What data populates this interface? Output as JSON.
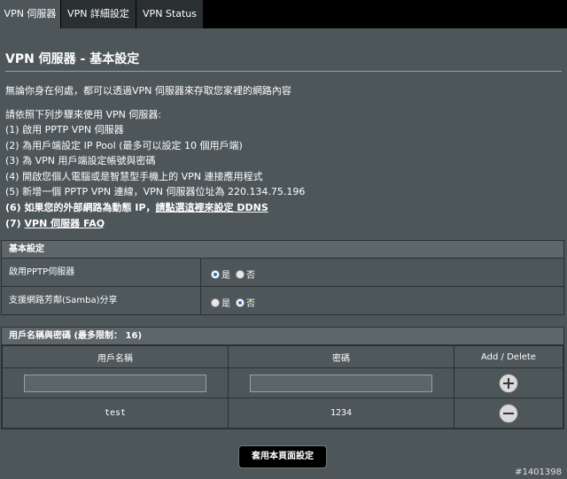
{
  "tabs": [
    {
      "label": "VPN 伺服器"
    },
    {
      "label": "VPN 詳細設定"
    },
    {
      "label": "VPN Status"
    }
  ],
  "page_title": "VPN 伺服器 - 基本設定",
  "intro": "無論你身在何處，都可以透過VPN 伺服器來存取您家裡的網路內容",
  "steps_heading": "請依照下列步驟來使用 VPN 伺服器:",
  "steps": [
    "(1) 啟用 PPTP VPN 伺服器",
    "(2) 為用戶端設定 IP Pool (最多可以設定 10 個用戶端)",
    "(3) 為 VPN 用戶端設定帳號與密碼",
    "(4) 開啟您個人電腦或是智慧型手機上的 VPN 連接應用程式",
    "(5) 新增一個 PPTP VPN 連線，VPN 伺服器位址為 220.134.75.196"
  ],
  "step6": {
    "text": "(6) 如果您的外部網路為動態 IP，",
    "link": "請點選這裡來設定 DDNS"
  },
  "step7": {
    "prefix": "(7) ",
    "link": "VPN 伺服器 FAQ"
  },
  "basic": {
    "header": "基本設定",
    "rows": [
      {
        "label": "啟用PPTP伺服器",
        "yes": "是",
        "no": "否",
        "selected": "yes"
      },
      {
        "label": "支援網路芳鄰(Samba)分享",
        "yes": "是",
        "no": "否",
        "selected": "no"
      }
    ]
  },
  "users": {
    "header": "用戶名稱與密碼 (最多限制： 16)",
    "col_user": "用戶名稱",
    "col_pass": "密碼",
    "col_action": "Add / Delete",
    "entries": [
      {
        "username": "test",
        "password": "1234"
      }
    ]
  },
  "apply_label": "套用本頁面設定",
  "watermark": "#1401398"
}
